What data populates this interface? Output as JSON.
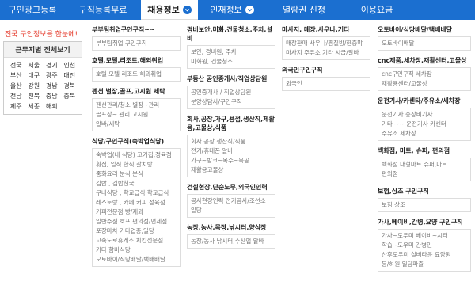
{
  "nav": [
    {
      "label": "구인광고등록",
      "active": false
    },
    {
      "label": "구직등록무료",
      "active": false
    },
    {
      "label": "채용정보",
      "active": true,
      "chevron": true
    },
    {
      "label": "인재정보",
      "active": false,
      "chevron": true
    },
    {
      "label": "열람권 신청",
      "active": false
    },
    {
      "label": "이용요금",
      "active": false
    }
  ],
  "promo": "전국 구인정보를 한눈에!",
  "regions": {
    "title": "근무지별 전체보기",
    "items": [
      "전국",
      "서울",
      "경기",
      "인천",
      "부산",
      "대구",
      "광주",
      "대전",
      "울산",
      "강원",
      "경남",
      "경북",
      "전남",
      "전북",
      "충남",
      "충북",
      "제주",
      "세종",
      "해외"
    ]
  },
  "columns": [
    [
      {
        "title": "부부팀취업구인구직~~",
        "items": [
          "부부팀취업 구인구직"
        ]
      },
      {
        "title": "호텔,모텔,리조트,해외취업",
        "items": [
          "호텔 모텔 리조트 해외취업"
        ]
      },
      {
        "title": "펜션 별장,골프,고시원 세탁",
        "items": [
          "펜션관리/청소 별장~관리",
          "골프장~ 관리 고시원",
          "알바/세탁"
        ]
      },
      {
        "title": "식당/구인구직(숙박업식당)",
        "items": [
          "숙박업(내 식당) 고기집,정육점",
          "횟집, 일식 한식 갈치탕",
          "중화요리 분식 분식",
          "김밥 , 김밥천국",
          "구내식당 , 학교급식 학교급식",
          "레스토랑 , 카페 커피 정육점",
          "커피전문점 빵/제과",
          "일반주점 호프 편의점/면세점",
          "포장마차 기타업종,일당",
          "고속도로휴게소 치킨전문점",
          "기타 함바식당",
          "오토바이/식당배달/택배배달"
        ]
      }
    ],
    [
      {
        "title": "경비보안,미화,건물청소,주차,설비",
        "items": [
          "보안, 경비원, 주차",
          "미화원, 건물청소"
        ]
      },
      {
        "title": "부동산 공인중개사/직업상담원",
        "items": [
          "공인중개사 / 직업상담원",
          "분양상담사/구인구직"
        ]
      },
      {
        "title": "회사,공장,가구,용접,생산직,제활용,고물상,식품",
        "items": [
          "회사 공장 생산직/식품",
          "전기/휴대폰 알바",
          "가구~방크~목수~목공",
          "재활용고물상"
        ]
      },
      {
        "title": "건설현장,단순노무,외국인인력",
        "items": [
          "공사현장인력 전기공사/조선소",
          "일당"
        ]
      },
      {
        "title": "농장,농사,목장,낚시터,양식장",
        "items": [
          "농장/농사 낚시터,수산업 알바"
        ]
      }
    ],
    [
      {
        "title": "마사지, 매장,사우나,기타",
        "items": [
          "매장판매 사우나/찜질방/한증막",
          "마사지 주유소 기타 시급/알바"
        ]
      },
      {
        "title": "외국인구인구직",
        "items": [
          "외국인"
        ]
      }
    ],
    [
      {
        "title": "오토바이/식당배달/택배배달",
        "items": [
          "오토바이배달"
        ]
      },
      {
        "title": "cnc제품,세차장,재활센터,고물상",
        "items": [
          "cnc구인구직 세차장",
          "재활용센터/고물상"
        ]
      },
      {
        "title": "운전기사/카센타/주유소/세차장",
        "items": [
          "운전기사 중장비기사",
          "기타 ~~ 운전기사 카센터",
          "주유소 세차장"
        ]
      },
      {
        "title": "백화점, 마트, 슈퍼, 편의점",
        "items": [
          "백화점 대형마트 슈퍼,마트",
          "편의점"
        ]
      },
      {
        "title": "보험,상조 구인구직",
        "items": [
          "보험 상조"
        ]
      },
      {
        "title": "가사,베이비,간병,요양 구인구직",
        "items": [
          "가사~도우미 베이비~시터",
          "학습~도우미 간병인",
          "산후도우미 실버타운 요양원",
          "등/하원 일당파출"
        ]
      }
    ]
  ]
}
